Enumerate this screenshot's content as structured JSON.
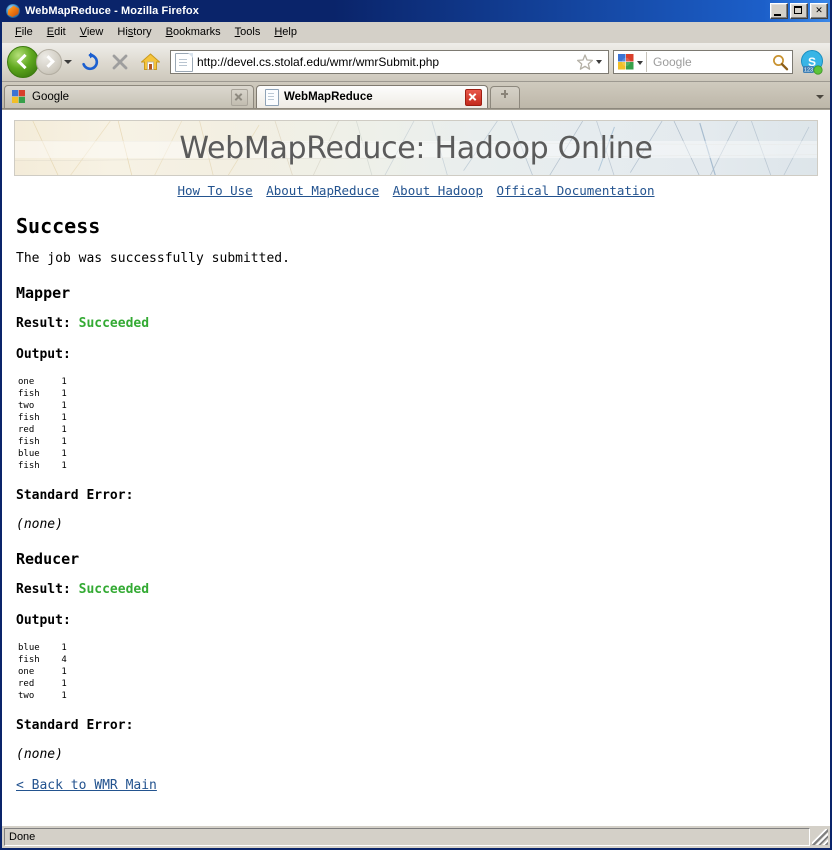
{
  "window": {
    "title": "WebMapReduce - Mozilla Firefox",
    "minimize_label": "Minimize",
    "maximize_label": "Maximize",
    "close_label": "Close"
  },
  "menubar": {
    "items": [
      {
        "label": "File",
        "accel": "F"
      },
      {
        "label": "Edit",
        "accel": "E"
      },
      {
        "label": "View",
        "accel": "V"
      },
      {
        "label": "History",
        "accel": "s"
      },
      {
        "label": "Bookmarks",
        "accel": "B"
      },
      {
        "label": "Tools",
        "accel": "T"
      },
      {
        "label": "Help",
        "accel": "H"
      }
    ]
  },
  "toolbar": {
    "back_label": "Back",
    "forward_label": "Forward",
    "history_dropdown_label": "Recent pages",
    "reload_label": "Reload",
    "stop_label": "Stop",
    "home_label": "Home",
    "url": "http://devel.cs.stolaf.edu/wmr/wmrSubmit.php",
    "bookmark_label": "Bookmark this page",
    "url_dropdown_label": "Show history",
    "search_engine": "Google",
    "search_placeholder": "Google",
    "search_value": "",
    "search_go_label": "Search",
    "skype_label": "Skype"
  },
  "tabs": {
    "items": [
      {
        "label": "Google",
        "active": false,
        "close_label": "Close tab"
      },
      {
        "label": "WebMapReduce",
        "active": true,
        "close_label": "Close tab"
      }
    ],
    "new_tab_label": "Open a new tab",
    "list_all_label": "List all tabs"
  },
  "page": {
    "banner_title": "WebMapReduce: Hadoop Online",
    "nav_links": [
      "How To Use",
      "About MapReduce",
      "About Hadoop",
      "Offical Documentation"
    ],
    "heading": "Success",
    "intro": "The job was successfully submitted.",
    "result_label": "Result:",
    "output_label": "Output:",
    "stderr_label": "Standard Error:",
    "none_text": "(none)",
    "back_link": "< Back to WMR Main",
    "success_color": "#33aa33",
    "link_color": "#23538f",
    "sections": [
      {
        "title": "Mapper",
        "result": "Succeeded",
        "output": "one\t1\nfish\t1\ntwo\t1\nfish\t1\nred\t1\nfish\t1\nblue\t1\nfish\t1",
        "output_rows": [
          {
            "key": "one",
            "value": "1"
          },
          {
            "key": "fish",
            "value": "1"
          },
          {
            "key": "two",
            "value": "1"
          },
          {
            "key": "fish",
            "value": "1"
          },
          {
            "key": "red",
            "value": "1"
          },
          {
            "key": "fish",
            "value": "1"
          },
          {
            "key": "blue",
            "value": "1"
          },
          {
            "key": "fish",
            "value": "1"
          }
        ],
        "stderr": "(none)"
      },
      {
        "title": "Reducer",
        "result": "Succeeded",
        "output": "blue\t1\nfish\t4\none\t1\nred\t1\ntwo\t1",
        "output_rows": [
          {
            "key": "blue",
            "value": "1"
          },
          {
            "key": "fish",
            "value": "4"
          },
          {
            "key": "one",
            "value": "1"
          },
          {
            "key": "red",
            "value": "1"
          },
          {
            "key": "two",
            "value": "1"
          }
        ],
        "stderr": "(none)"
      }
    ]
  },
  "statusbar": {
    "text": "Done",
    "resize_label": "Resize window"
  }
}
